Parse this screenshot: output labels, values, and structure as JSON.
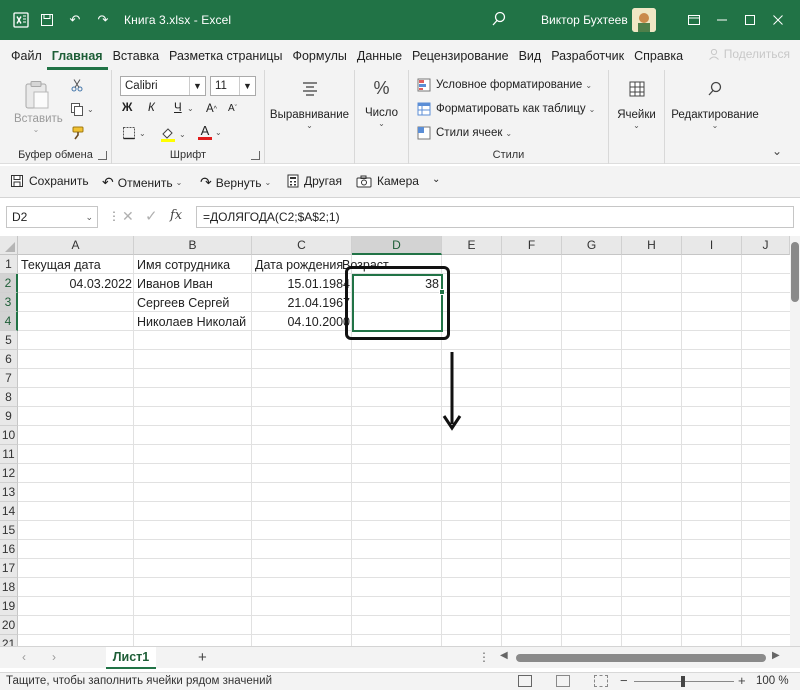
{
  "app": {
    "title": "Книга 3.xlsx  -  Excel",
    "user": "Виктор Бухтеев",
    "colors": {
      "brand": "#217346",
      "selection": "#217346"
    }
  },
  "tabs": [
    "Файл",
    "Главная",
    "Вставка",
    "Разметка страницы",
    "Формулы",
    "Данные",
    "Рецензирование",
    "Вид",
    "Разработчик",
    "Справка"
  ],
  "share_label": "Поделиться",
  "ribbon": {
    "clipboard": {
      "label": "Буфер обмена",
      "paste": "Вставить"
    },
    "font": {
      "label": "Шрифт",
      "name": "Calibri",
      "size": "11",
      "bold": "Ж",
      "italic": "К",
      "underline": "Ч"
    },
    "alignment": {
      "label": "Выравнивание"
    },
    "number": {
      "label": "Число"
    },
    "styles": {
      "label": "Стили",
      "cond": "Условное форматирование",
      "table": "Форматировать как таблицу",
      "cell": "Стили ячеек"
    },
    "cells": {
      "label": "Ячейки"
    },
    "editing": {
      "label": "Редактирование"
    }
  },
  "qat": {
    "save": "Сохранить",
    "undo": "Отменить",
    "redo": "Вернуть",
    "other": "Другая",
    "camera": "Камера"
  },
  "formula_bar": {
    "name_box": "D2",
    "fx": "fx",
    "formula": "=ДОЛЯГОДА(C2;$A$2;1)"
  },
  "grid": {
    "columns": [
      "A",
      "B",
      "C",
      "D",
      "E",
      "F",
      "G",
      "H",
      "I",
      "J"
    ],
    "rows": [
      "1",
      "2",
      "3",
      "4",
      "5",
      "6",
      "7",
      "8",
      "9",
      "10",
      "11",
      "12",
      "13",
      "14",
      "15",
      "16",
      "17",
      "18",
      "19",
      "20",
      "21"
    ],
    "cells": {
      "a1": "Текущая дата",
      "b1": "Имя сотрудника",
      "c1": "Дата рождения",
      "d1": "Возраст",
      "a2": "04.03.2022",
      "b2": "Иванов Иван",
      "c2": "15.01.1984",
      "d2": "38",
      "b3": "Сергеев Сергей",
      "c3": "21.04.1967",
      "b4": "Николаев Николай",
      "c4": "04.10.2000"
    }
  },
  "sheets": {
    "active": "Лист1",
    "add": "+"
  },
  "status": {
    "message": "Тащите, чтобы заполнить ячейки рядом значений",
    "zoom": "100 %"
  }
}
